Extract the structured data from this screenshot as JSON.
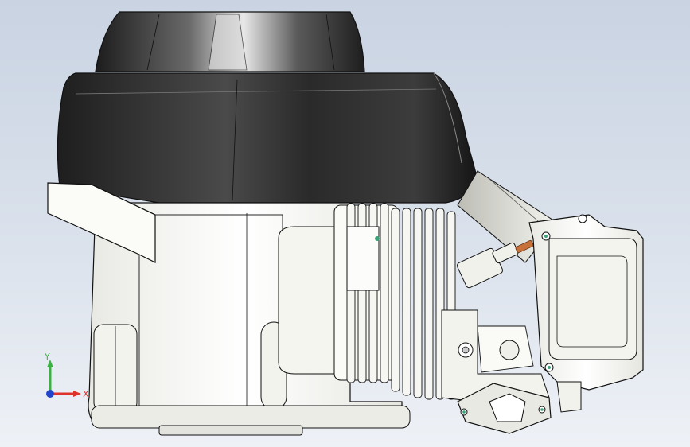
{
  "viewport": {
    "background_top": "#c9d3e2",
    "background_bottom": "#eef1f6"
  },
  "model": {
    "parts": [
      "air-cleaner-cover",
      "fuel-tank",
      "crankcase",
      "cylinder-fins",
      "spark-plug",
      "cylinder-head",
      "muffler",
      "intake-flange"
    ],
    "colors": {
      "dark_shell": "#2c2c2c",
      "body": "#f7f7f2",
      "edge": "#1a1a1a",
      "plug_tip": "#c8703a",
      "hole": "#3aa37a"
    }
  },
  "triad": {
    "x_label": "X",
    "y_label": "Y",
    "x_color": "#e0322c",
    "y_color": "#3cb043",
    "z_color": "#2244cc"
  }
}
